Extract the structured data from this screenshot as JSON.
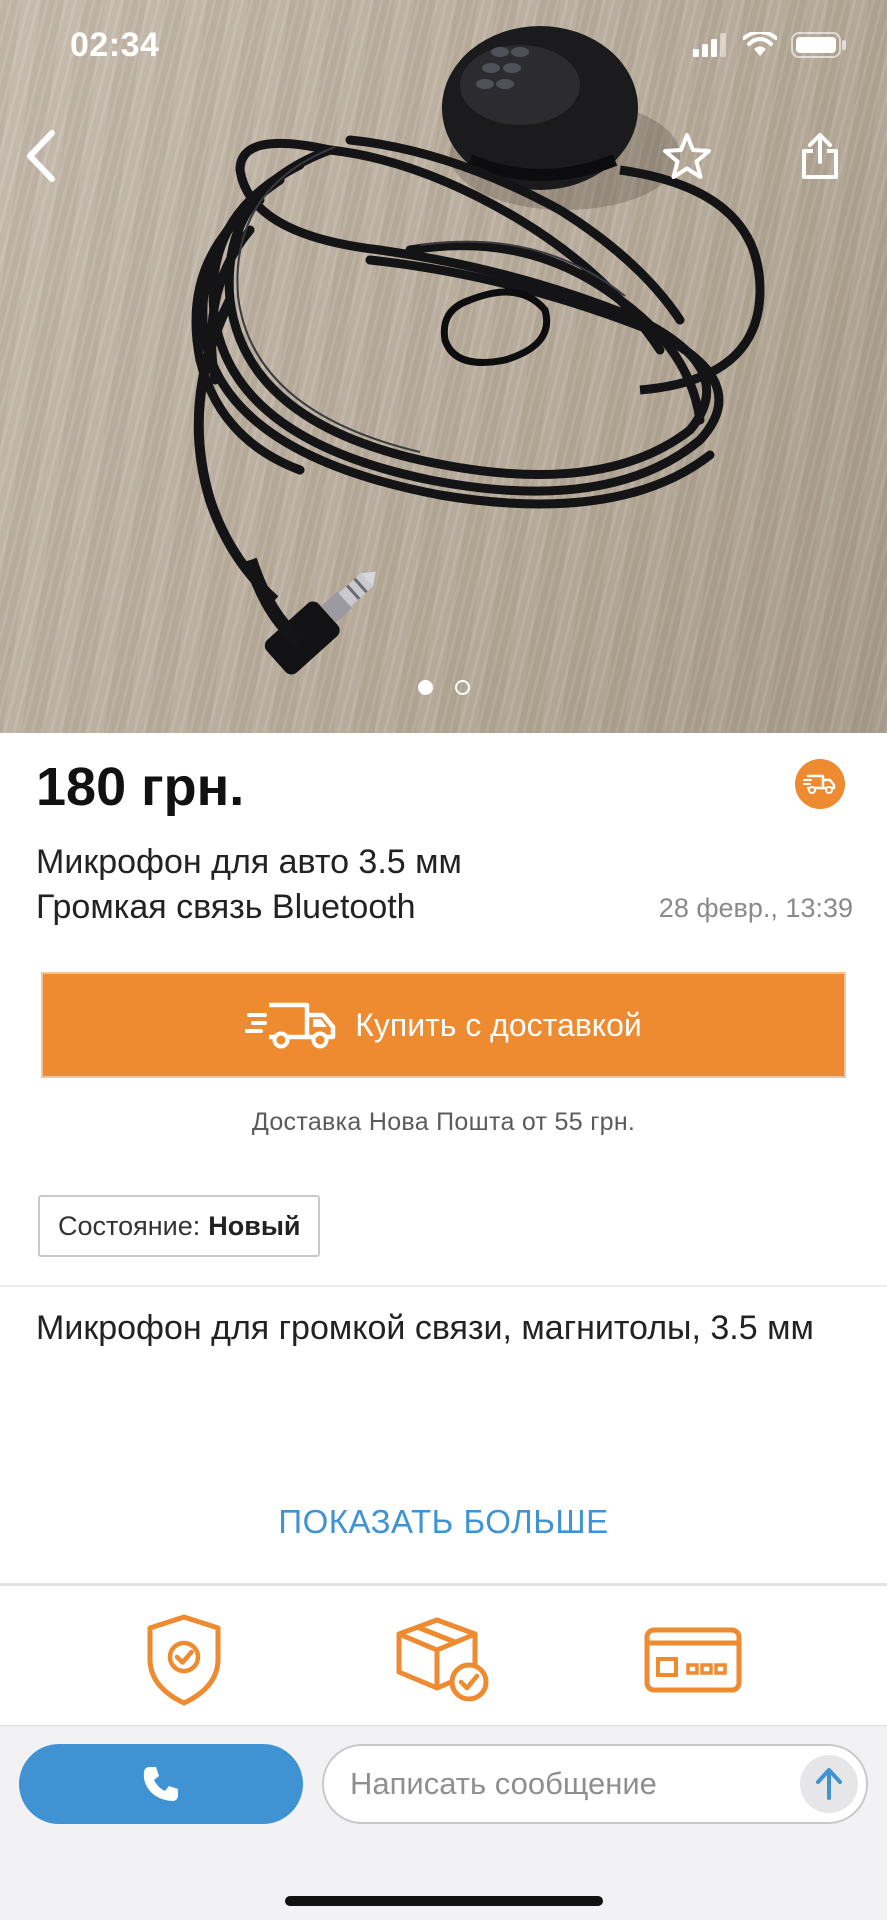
{
  "status_bar": {
    "time": "02:34",
    "icons": [
      "cellular-signal-icon",
      "wifi-icon",
      "battery-icon"
    ]
  },
  "gallery": {
    "image_subject": "photo",
    "page_count": 2,
    "current_page": 1,
    "actions": [
      "back-arrow-icon",
      "star-icon",
      "share-icon"
    ]
  },
  "listing": {
    "price": "180 грн.",
    "title": "Микрофон для авто 3.5 мм Громкая связь Bluetooth",
    "posted": "28 февр., 13:39",
    "delivery_badge_icon": "delivery-truck-icon"
  },
  "buy": {
    "label": "Купить с доставкой",
    "icon": "fast-truck-icon",
    "delivery_note": "Доставка Нова Пошта от 55 грн."
  },
  "condition": {
    "label": "Состояние:",
    "value": "Новый"
  },
  "description": {
    "text": "Микрофон для громкой связи, магнитолы, 3.5 мм",
    "show_more": "ПОКАЗАТЬ БОЛЬШЕ"
  },
  "features": [
    "shield-check-icon",
    "box-check-icon",
    "payment-card-icon"
  ],
  "bottom_bar": {
    "call_icon": "phone-icon",
    "message_placeholder": "Написать сообщение",
    "send_icon": "send-arrow-icon"
  },
  "colors": {
    "accent_orange": "#ee8a30",
    "link_blue": "#3f93d2",
    "text_dark": "#1a1a1a",
    "text_muted": "#8a8a8a"
  }
}
